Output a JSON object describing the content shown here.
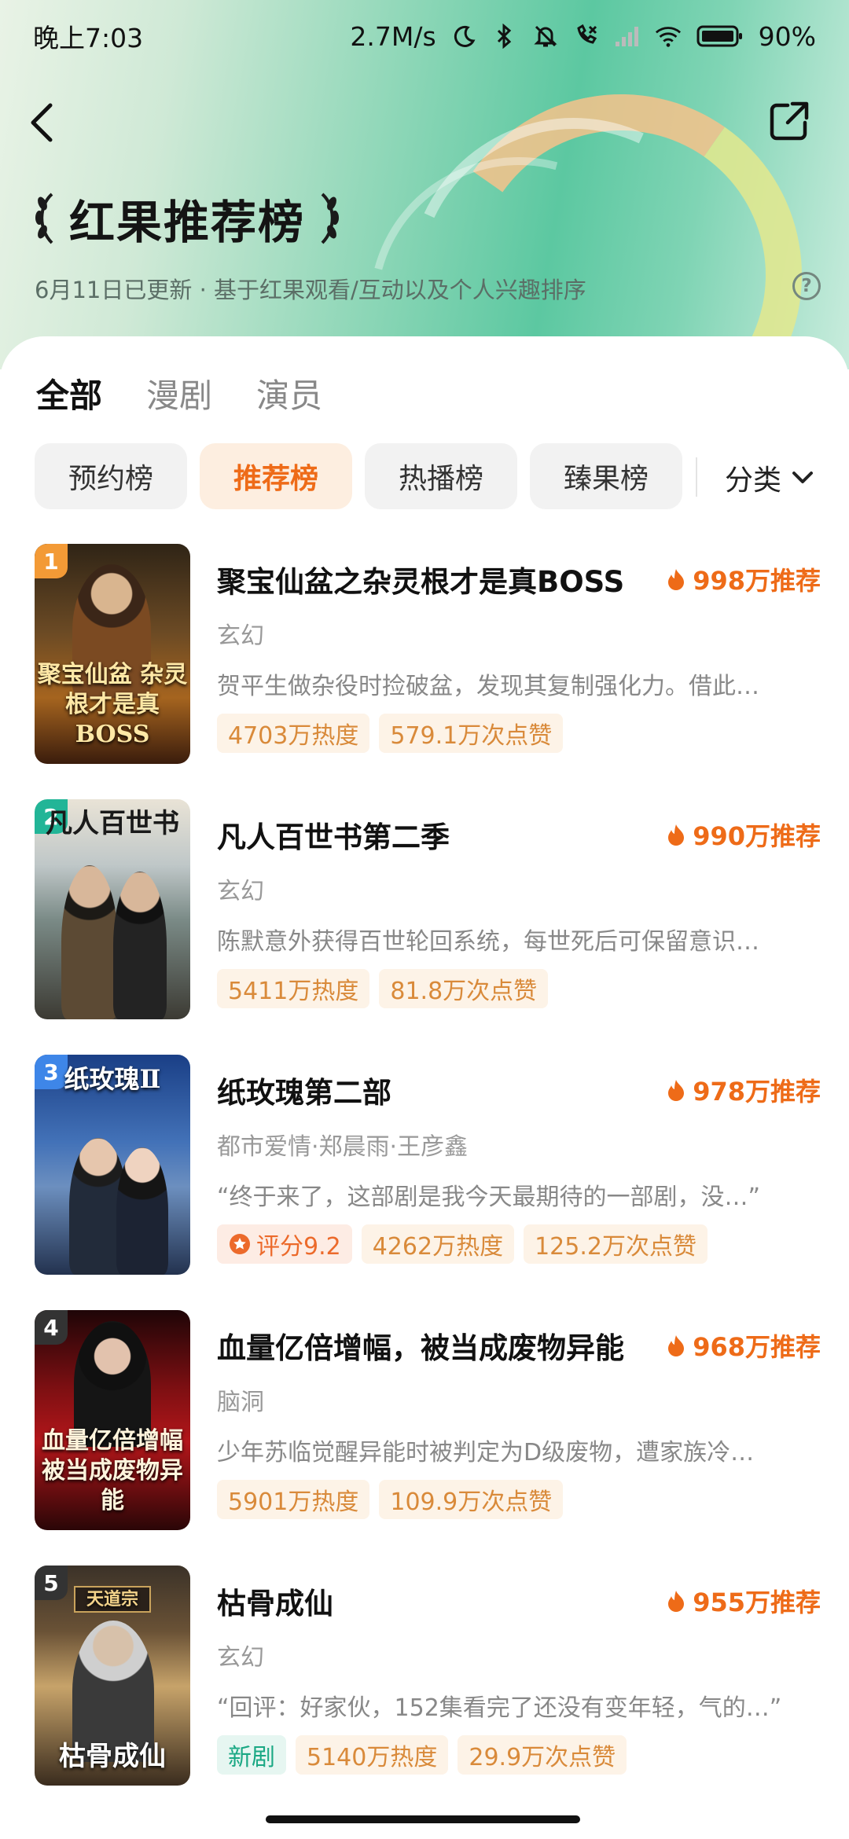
{
  "status_bar": {
    "time": "晚上7:03",
    "speed": "2.7M/s",
    "battery": "90%"
  },
  "header": {
    "title": "红果推荐榜",
    "subtitle": "6月11日已更新 · 基于红果观看/互动以及个人兴趣排序",
    "help_icon": "?"
  },
  "tabs": [
    "全部",
    "漫剧",
    "演员"
  ],
  "chips": [
    "预约榜",
    "推荐榜",
    "热播榜",
    "臻果榜"
  ],
  "category_label": "分类",
  "colors": {
    "accent": "#ee6b18",
    "rank1": "#f39a36",
    "rank2": "#22b597",
    "rank3": "#3e86e8",
    "rank_other": "#333333"
  },
  "items": [
    {
      "rank": "1",
      "title": "聚宝仙盆之杂灵根才是真BOSS",
      "recommend": "998万推荐",
      "genre": "玄幻",
      "desc": "贺平生做杂役时捡破盆，发现其复制强化力。借此…",
      "tags": [
        "4703万热度",
        "579.1万次点赞"
      ],
      "poster_text": "聚宝仙盆 杂灵根才是真BOSS"
    },
    {
      "rank": "2",
      "title": "凡人百世书第二季",
      "recommend": "990万推荐",
      "genre": "玄幻",
      "desc": "陈默意外获得百世轮回系统，每世死后可保留意识…",
      "tags": [
        "5411万热度",
        "81.8万次点赞"
      ],
      "poster_text": "凡人百世书"
    },
    {
      "rank": "3",
      "title": "纸玫瑰第二部",
      "recommend": "978万推荐",
      "genre": "都市爱情·郑晨雨·王彦鑫",
      "desc": "“终于来了，这部剧是我今天最期待的一部剧，没…”",
      "score": "评分9.2",
      "tags": [
        "4262万热度",
        "125.2万次点赞"
      ],
      "poster_text": "纸玫瑰Ⅱ"
    },
    {
      "rank": "4",
      "title": "血量亿倍增幅，被当成废物异能",
      "recommend": "968万推荐",
      "genre": "脑洞",
      "desc": "少年苏临觉醒异能时被判定为D级废物，遭家族冷…",
      "tags": [
        "5901万热度",
        "109.9万次点赞"
      ],
      "poster_text": "血量亿倍增幅 被当成废物异能"
    },
    {
      "rank": "5",
      "title": "枯骨成仙",
      "recommend": "955万推荐",
      "genre": "玄幻",
      "desc": "“回评：好家伙，152集看完了还没有变年轻，气的…”",
      "new_tag": "新剧",
      "tags": [
        "5140万热度",
        "29.9万次点赞"
      ],
      "poster_text": "枯骨成仙",
      "poster_sign": "天道宗"
    }
  ]
}
